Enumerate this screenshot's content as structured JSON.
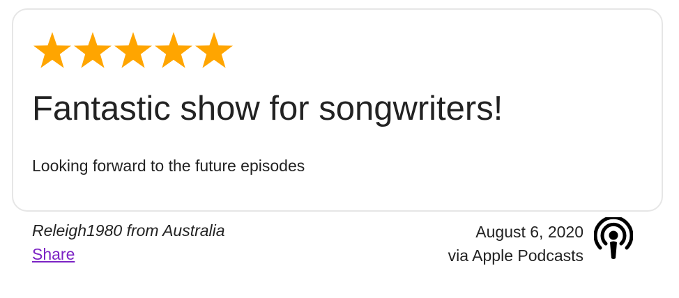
{
  "review": {
    "rating": 5,
    "rating_max": 5,
    "star_color": "#ffa500",
    "title": "Fantastic show for songwriters!",
    "body": "Looking forward to the future episodes"
  },
  "footer": {
    "author": "Releigh1980 from Australia",
    "share_label": "Share",
    "date": "August 6, 2020",
    "source": "via Apple Podcasts",
    "source_icon": "apple-podcasts-icon"
  }
}
